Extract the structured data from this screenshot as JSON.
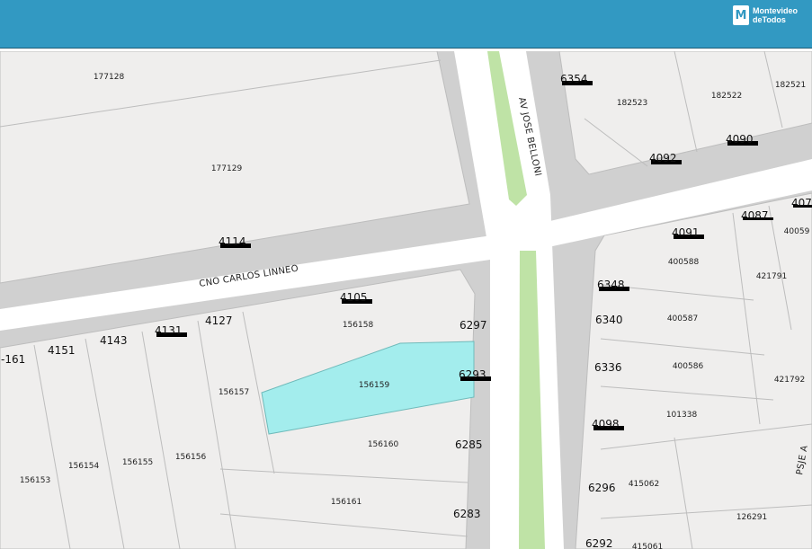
{
  "header": {
    "brand_line1": "Montevideo",
    "brand_line2": "deTodos",
    "brand_icon": "building-icon"
  },
  "streets": [
    {
      "id": "carlos-linneo",
      "text": "CNO CARLOS LINNEO"
    },
    {
      "id": "jose-belloni",
      "text": "AV JOSE BELLONI"
    }
  ],
  "parcels": [
    {
      "id": "p177128",
      "text": "177128"
    },
    {
      "id": "p177129",
      "text": "177129"
    },
    {
      "id": "p182523",
      "text": "182523"
    },
    {
      "id": "p182522",
      "text": "182522"
    },
    {
      "id": "p182521",
      "text": "182521"
    },
    {
      "id": "p400588",
      "text": "400588"
    },
    {
      "id": "p400587",
      "text": "400587"
    },
    {
      "id": "p400586",
      "text": "400586"
    },
    {
      "id": "p101338",
      "text": "101338"
    },
    {
      "id": "p415062",
      "text": "415062"
    },
    {
      "id": "p415061",
      "text": "415061"
    },
    {
      "id": "p126291",
      "text": "126291"
    },
    {
      "id": "p421791",
      "text": "421791"
    },
    {
      "id": "p421792",
      "text": "421792"
    },
    {
      "id": "p40059",
      "text": "40059"
    },
    {
      "id": "p156158",
      "text": "156158"
    },
    {
      "id": "p156159",
      "text": "156159"
    },
    {
      "id": "p156157",
      "text": "156157"
    },
    {
      "id": "p156160",
      "text": "156160"
    },
    {
      "id": "p156161",
      "text": "156161"
    },
    {
      "id": "p156156",
      "text": "156156"
    },
    {
      "id": "p156155",
      "text": "156155"
    },
    {
      "id": "p156154",
      "text": "156154"
    },
    {
      "id": "p156153",
      "text": "156153"
    }
  ],
  "door_numbers": [
    {
      "id": "d6354",
      "text": "6354"
    },
    {
      "id": "d4090",
      "text": "4090"
    },
    {
      "id": "d4092",
      "text": "4092"
    },
    {
      "id": "d4087",
      "text": "4087"
    },
    {
      "id": "d407",
      "text": "407"
    },
    {
      "id": "d4091",
      "text": "4091"
    },
    {
      "id": "d6348",
      "text": "6348"
    },
    {
      "id": "d6340",
      "text": "6340"
    },
    {
      "id": "d6336",
      "text": "6336"
    },
    {
      "id": "d4098",
      "text": "4098"
    },
    {
      "id": "d6296",
      "text": "6296"
    },
    {
      "id": "d6292",
      "text": "6292"
    },
    {
      "id": "d4114",
      "text": "4114"
    },
    {
      "id": "d4105",
      "text": "4105"
    },
    {
      "id": "d6297",
      "text": "6297"
    },
    {
      "id": "d6293",
      "text": "6293"
    },
    {
      "id": "d6285",
      "text": "6285"
    },
    {
      "id": "d6283",
      "text": "6283"
    },
    {
      "id": "d4127",
      "text": "4127"
    },
    {
      "id": "d4131",
      "text": "4131"
    },
    {
      "id": "d4143",
      "text": "4143"
    },
    {
      "id": "d4151",
      "text": "4151"
    },
    {
      "id": "d4161",
      "text": "-161"
    }
  ],
  "edge_label": "PSJE A",
  "colors": {
    "header": "#3299c2",
    "lot": "#efeeed",
    "sidewalk": "#d0d0d0",
    "road": "#ffffff",
    "median": "#bfe3a6",
    "selected": "#a3eded"
  }
}
